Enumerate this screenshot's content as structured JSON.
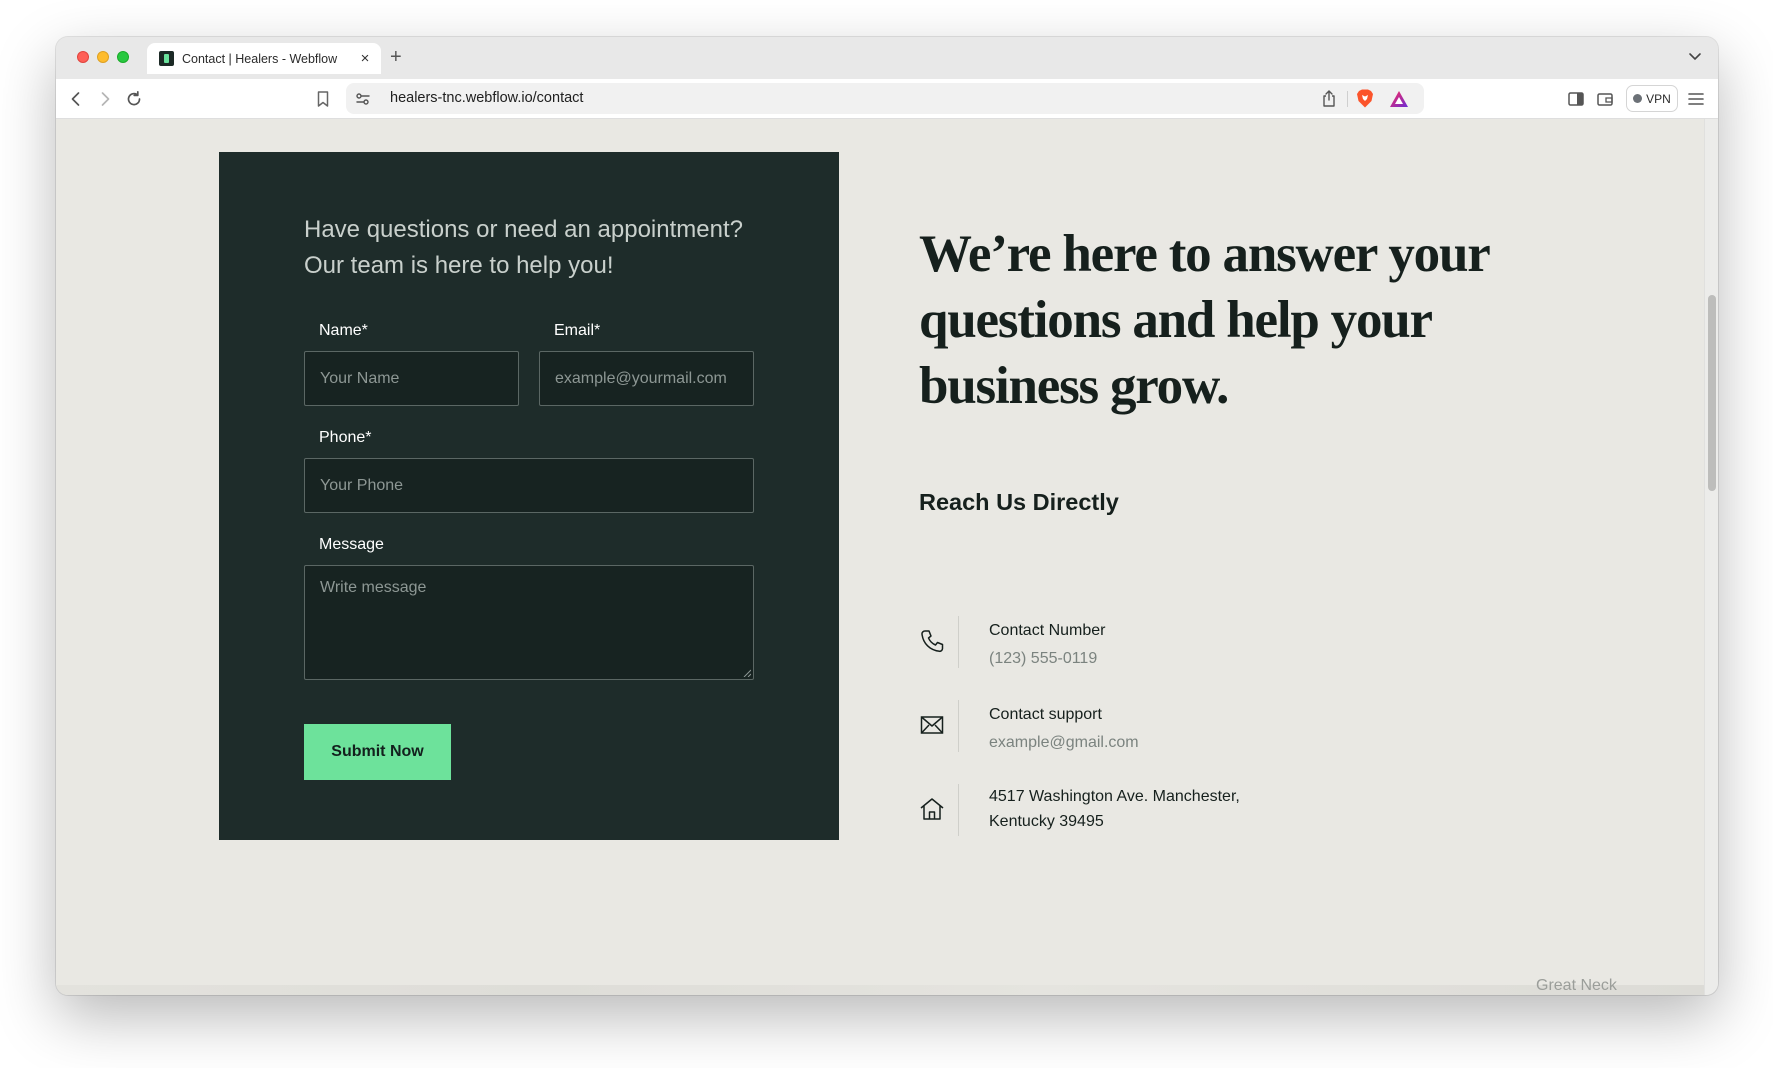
{
  "browser": {
    "tab_title": "Contact | Healers - Webflow",
    "url": "healers-tnc.webflow.io/contact",
    "vpn_label": "VPN"
  },
  "form": {
    "heading": "Have questions or need an appointment? Our team is here to help you!",
    "name_label": "Name*",
    "name_placeholder": "Your Name",
    "email_label": "Email*",
    "email_placeholder": "example@yourmail.com",
    "phone_label": "Phone*",
    "phone_placeholder": "Your Phone",
    "message_label": "Message",
    "message_placeholder": "Write message",
    "submit_label": "Submit Now"
  },
  "info": {
    "headline": "We’re here to answer your questions and help your business grow.",
    "reach_title": "Reach Us Directly",
    "contacts": [
      {
        "icon": "phone-icon",
        "title": "Contact Number",
        "value": "(123) 555-0119"
      },
      {
        "icon": "mail-icon",
        "title": "Contact support",
        "value": "example@gmail.com"
      },
      {
        "icon": "home-icon",
        "address": "4517 Washington Ave. Manchester, Kentucky 39495"
      }
    ]
  },
  "map": {
    "label": "Great Neck"
  },
  "colors": {
    "page_bg": "#e9e8e3",
    "card_bg": "#1e2c2a",
    "accent": "#6de29b",
    "heading": "#16201d",
    "muted": "#7b837f"
  }
}
